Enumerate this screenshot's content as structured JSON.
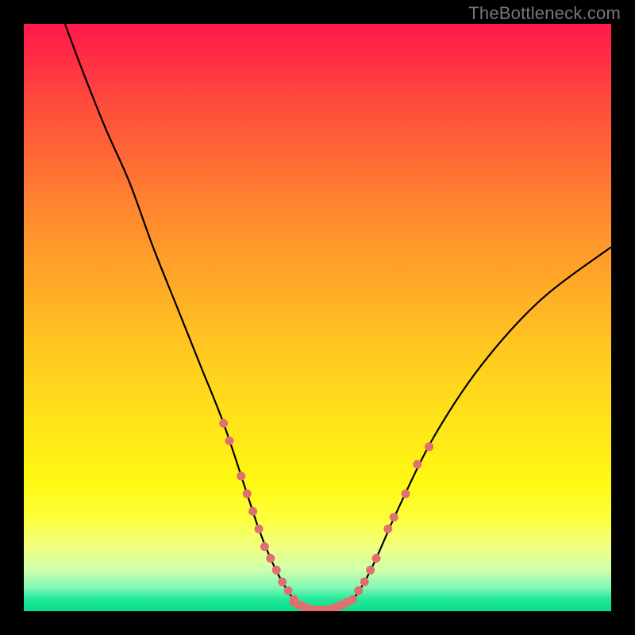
{
  "watermark": "TheBottleneck.com",
  "chart_data": {
    "type": "line",
    "title": "",
    "xlabel": "",
    "ylabel": "",
    "xlim": [
      0,
      100
    ],
    "ylim": [
      0,
      100
    ],
    "series": [
      {
        "name": "bottleneck-curve",
        "color": "#000000",
        "x": [
          7,
          10,
          14,
          18,
          22,
          26,
          30,
          34,
          38,
          40,
          42,
          44,
          46,
          48,
          50,
          52,
          54,
          56,
          58,
          60,
          64,
          70,
          78,
          88,
          100
        ],
        "y": [
          100,
          92,
          82,
          73,
          62,
          52,
          42,
          32,
          20,
          14,
          9,
          5,
          2,
          0.7,
          0.2,
          0.2,
          0.7,
          2,
          5,
          9,
          18,
          30,
          42,
          53,
          62
        ]
      }
    ],
    "markers": {
      "name": "highlight-dots",
      "color": "#e07070",
      "points_left": [
        {
          "x": 34,
          "y": 32
        },
        {
          "x": 35,
          "y": 29
        },
        {
          "x": 37,
          "y": 23
        },
        {
          "x": 38,
          "y": 20
        },
        {
          "x": 39,
          "y": 17
        },
        {
          "x": 40,
          "y": 14
        },
        {
          "x": 41,
          "y": 11
        },
        {
          "x": 42,
          "y": 9
        },
        {
          "x": 43,
          "y": 7
        },
        {
          "x": 44,
          "y": 5
        },
        {
          "x": 45,
          "y": 3.5
        },
        {
          "x": 46,
          "y": 2
        }
      ],
      "points_bottom": [
        {
          "x": 46,
          "y": 1.5
        },
        {
          "x": 47,
          "y": 1.0
        },
        {
          "x": 48,
          "y": 0.6
        },
        {
          "x": 49,
          "y": 0.3
        },
        {
          "x": 50,
          "y": 0.2
        },
        {
          "x": 51,
          "y": 0.2
        },
        {
          "x": 52,
          "y": 0.3
        },
        {
          "x": 53,
          "y": 0.6
        },
        {
          "x": 54,
          "y": 1.0
        },
        {
          "x": 55,
          "y": 1.5
        }
      ],
      "points_right": [
        {
          "x": 56,
          "y": 2
        },
        {
          "x": 57,
          "y": 3.5
        },
        {
          "x": 58,
          "y": 5
        },
        {
          "x": 59,
          "y": 7
        },
        {
          "x": 60,
          "y": 9
        },
        {
          "x": 62,
          "y": 14
        },
        {
          "x": 63,
          "y": 16
        },
        {
          "x": 65,
          "y": 20
        },
        {
          "x": 67,
          "y": 25
        },
        {
          "x": 69,
          "y": 28
        }
      ]
    }
  }
}
